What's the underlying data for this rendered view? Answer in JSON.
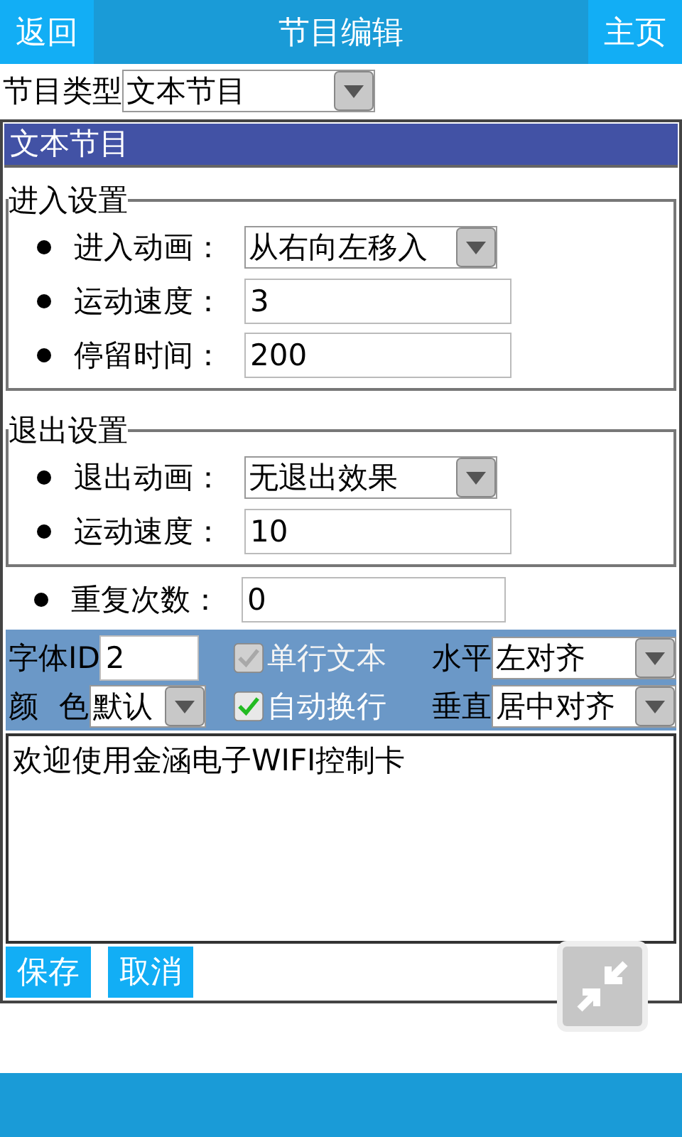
{
  "header": {
    "back": "返回",
    "title": "节目编辑",
    "home": "主页"
  },
  "program_type": {
    "label": "节目类型",
    "value": "文本节目"
  },
  "panel_title": "文本节目",
  "sections": [
    {
      "legend": "进入设置",
      "rows": [
        {
          "kind": "select",
          "label": "进入动画：",
          "value": "从右向左移入"
        },
        {
          "kind": "input",
          "label": "运动速度：",
          "value": "3"
        },
        {
          "kind": "input",
          "label": "停留时间：",
          "value": "200"
        }
      ]
    },
    {
      "legend": "退出设置",
      "rows": [
        {
          "kind": "select",
          "label": "退出动画：",
          "value": "无退出效果"
        },
        {
          "kind": "input",
          "label": "运动速度：",
          "value": "10"
        }
      ]
    }
  ],
  "repeat": {
    "label": "重复次数：",
    "value": "0"
  },
  "font_id": {
    "label": "字体ID",
    "value": "2"
  },
  "color": {
    "label": "颜 色",
    "value": "默认"
  },
  "options": [
    {
      "label": "单行文本",
      "checked": true,
      "disabled": true
    },
    {
      "label": "自动换行",
      "checked": true,
      "disabled": false
    }
  ],
  "align": [
    {
      "label": "水平",
      "value": "左对齐"
    },
    {
      "label": "垂直",
      "value": "居中对齐"
    }
  ],
  "content": "欢迎使用金涵电子WIFI控制卡",
  "buttons": [
    "保存",
    "取消"
  ]
}
